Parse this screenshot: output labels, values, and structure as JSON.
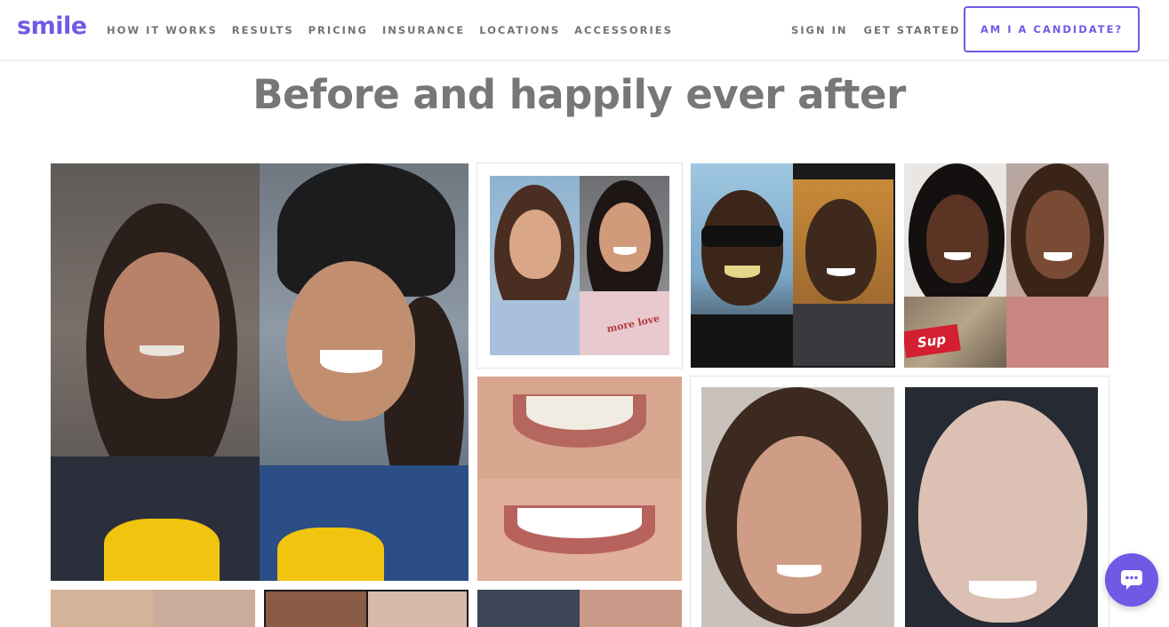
{
  "brand": {
    "logo_text": "smile",
    "accent_color": "#6f5ae6"
  },
  "nav": {
    "left": [
      "HOW IT WORKS",
      "RESULTS",
      "PRICING",
      "INSURANCE",
      "LOCATIONS",
      "ACCESSORIES"
    ],
    "right": [
      "SIGN IN",
      "GET STARTED"
    ],
    "cta_label": "AM I A CANDIDATE?"
  },
  "page": {
    "heading": "Before and happily ever after"
  },
  "gallery": {
    "photo_text": {
      "shirt_text_1": "more love",
      "shirt_text_2": "Sup"
    }
  },
  "chat": {
    "icon": "chat-bubble-icon"
  }
}
